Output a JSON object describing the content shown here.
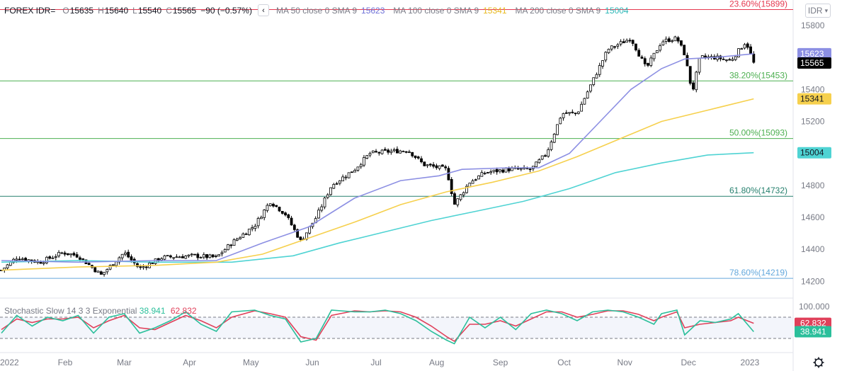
{
  "header": {
    "symbol": "FOREX IDR=",
    "o_label": "O",
    "o_value": "15635",
    "h_label": "H",
    "h_value": "15640",
    "l_label": "L",
    "l_value": "15540",
    "c_label": "C",
    "c_value": "15565",
    "change": "−90 (−0.57%)",
    "collapse_icon": "chevron-left-icon",
    "ma50_label": "MA 50 close 0 SMA 9",
    "ma50_value": "15623",
    "ma100_label": "MA 100 close 0 SMA 9",
    "ma100_value": "15341",
    "ma200_label": "MA 200 close 0 SMA 9",
    "ma200_value": "15004",
    "currency_button": "IDR"
  },
  "stochastic": {
    "label": "Stochastic Slow 14 3 3 Exponential",
    "k_value": "38.941",
    "d_value": "62.832",
    "scale_top": "100.000"
  },
  "colors": {
    "up": "#ffffff",
    "down": "#000000",
    "candle_border": "#000000",
    "ma50": "#8c8fe3",
    "ma100": "#f6d04d",
    "ma200": "#4fd3d3",
    "fib_red": "#e53950",
    "fib_green": "#4caf50",
    "fib_teal": "#26806e",
    "fib_blue": "#64a8dc",
    "stoch_k": "#2bbf9b",
    "stoch_d": "#e0405a",
    "price_label_bg": "#000000"
  },
  "chart_data": {
    "type": "candlestick",
    "y_range": [
      14100,
      15950
    ],
    "y_ticks": [
      14200,
      14400,
      14600,
      14800,
      15000,
      15200,
      15400,
      15600,
      15800
    ],
    "x_labels": [
      "2022",
      "Feb",
      "Mar",
      "Apr",
      "May",
      "Jun",
      "Jul",
      "Aug",
      "Sep",
      "Oct",
      "Nov",
      "Dec",
      "2023"
    ],
    "fib_levels": [
      {
        "label": "23.60%(15899)",
        "value": 15899,
        "color": "#e53950"
      },
      {
        "label": "38.20%(15453)",
        "value": 15453,
        "color": "#4caf50"
      },
      {
        "label": "50.00%(15093)",
        "value": 15093,
        "color": "#4caf50"
      },
      {
        "label": "61.80%(14732)",
        "value": 14732,
        "color": "#26806e"
      },
      {
        "label": "78.60%(14219)",
        "value": 14219,
        "color": "#64a8dc"
      }
    ],
    "last_price": "15565",
    "series": [
      {
        "name": "MA 50 close 0 SMA 9",
        "last": 15623
      },
      {
        "name": "MA 100 close 0 SMA 9",
        "last": 15341
      },
      {
        "name": "MA 200 close 0 SMA 9",
        "last": 15004
      }
    ],
    "close_path": [
      {
        "x": 0.0,
        "y": 14270
      },
      {
        "x": 0.02,
        "y": 14350
      },
      {
        "x": 0.05,
        "y": 14320
      },
      {
        "x": 0.08,
        "y": 14380
      },
      {
        "x": 0.1,
        "y": 14360
      },
      {
        "x": 0.13,
        "y": 14240
      },
      {
        "x": 0.16,
        "y": 14380
      },
      {
        "x": 0.18,
        "y": 14280
      },
      {
        "x": 0.21,
        "y": 14350
      },
      {
        "x": 0.25,
        "y": 14360
      },
      {
        "x": 0.28,
        "y": 14350
      },
      {
        "x": 0.3,
        "y": 14440
      },
      {
        "x": 0.33,
        "y": 14550
      },
      {
        "x": 0.35,
        "y": 14700
      },
      {
        "x": 0.37,
        "y": 14620
      },
      {
        "x": 0.39,
        "y": 14450
      },
      {
        "x": 0.41,
        "y": 14600
      },
      {
        "x": 0.43,
        "y": 14800
      },
      {
        "x": 0.46,
        "y": 14900
      },
      {
        "x": 0.48,
        "y": 15000
      },
      {
        "x": 0.5,
        "y": 15010
      },
      {
        "x": 0.53,
        "y": 15020
      },
      {
        "x": 0.55,
        "y": 14930
      },
      {
        "x": 0.58,
        "y": 14900
      },
      {
        "x": 0.59,
        "y": 14680
      },
      {
        "x": 0.61,
        "y": 14820
      },
      {
        "x": 0.63,
        "y": 14880
      },
      {
        "x": 0.66,
        "y": 14900
      },
      {
        "x": 0.69,
        "y": 14900
      },
      {
        "x": 0.71,
        "y": 15000
      },
      {
        "x": 0.73,
        "y": 15250
      },
      {
        "x": 0.75,
        "y": 15250
      },
      {
        "x": 0.77,
        "y": 15450
      },
      {
        "x": 0.79,
        "y": 15650
      },
      {
        "x": 0.82,
        "y": 15720
      },
      {
        "x": 0.84,
        "y": 15530
      },
      {
        "x": 0.86,
        "y": 15700
      },
      {
        "x": 0.88,
        "y": 15720
      },
      {
        "x": 0.89,
        "y": 15620
      },
      {
        "x": 0.9,
        "y": 15380
      },
      {
        "x": 0.91,
        "y": 15600
      },
      {
        "x": 0.93,
        "y": 15600
      },
      {
        "x": 0.95,
        "y": 15580
      },
      {
        "x": 0.97,
        "y": 15700
      },
      {
        "x": 0.98,
        "y": 15565
      }
    ],
    "ma50_path": [
      {
        "x": 0.0,
        "y": 14330
      },
      {
        "x": 0.1,
        "y": 14320
      },
      {
        "x": 0.2,
        "y": 14330
      },
      {
        "x": 0.28,
        "y": 14330
      },
      {
        "x": 0.34,
        "y": 14440
      },
      {
        "x": 0.4,
        "y": 14540
      },
      {
        "x": 0.46,
        "y": 14720
      },
      {
        "x": 0.52,
        "y": 14830
      },
      {
        "x": 0.57,
        "y": 14860
      },
      {
        "x": 0.6,
        "y": 14900
      },
      {
        "x": 0.66,
        "y": 14910
      },
      {
        "x": 0.7,
        "y": 14910
      },
      {
        "x": 0.74,
        "y": 15000
      },
      {
        "x": 0.78,
        "y": 15200
      },
      {
        "x": 0.82,
        "y": 15400
      },
      {
        "x": 0.86,
        "y": 15530
      },
      {
        "x": 0.89,
        "y": 15590
      },
      {
        "x": 0.93,
        "y": 15600
      },
      {
        "x": 0.98,
        "y": 15623
      }
    ],
    "ma100_path": [
      {
        "x": 0.0,
        "y": 14270
      },
      {
        "x": 0.1,
        "y": 14290
      },
      {
        "x": 0.2,
        "y": 14300
      },
      {
        "x": 0.28,
        "y": 14320
      },
      {
        "x": 0.34,
        "y": 14370
      },
      {
        "x": 0.4,
        "y": 14470
      },
      {
        "x": 0.46,
        "y": 14570
      },
      {
        "x": 0.52,
        "y": 14680
      },
      {
        "x": 0.58,
        "y": 14760
      },
      {
        "x": 0.64,
        "y": 14820
      },
      {
        "x": 0.7,
        "y": 14890
      },
      {
        "x": 0.75,
        "y": 14980
      },
      {
        "x": 0.8,
        "y": 15080
      },
      {
        "x": 0.86,
        "y": 15200
      },
      {
        "x": 0.92,
        "y": 15270
      },
      {
        "x": 0.98,
        "y": 15341
      }
    ],
    "ma200_path": [
      {
        "x": 0.0,
        "y": 14320
      },
      {
        "x": 0.1,
        "y": 14330
      },
      {
        "x": 0.2,
        "y": 14320
      },
      {
        "x": 0.3,
        "y": 14320
      },
      {
        "x": 0.38,
        "y": 14360
      },
      {
        "x": 0.44,
        "y": 14440
      },
      {
        "x": 0.5,
        "y": 14510
      },
      {
        "x": 0.56,
        "y": 14580
      },
      {
        "x": 0.62,
        "y": 14640
      },
      {
        "x": 0.68,
        "y": 14700
      },
      {
        "x": 0.74,
        "y": 14780
      },
      {
        "x": 0.8,
        "y": 14880
      },
      {
        "x": 0.86,
        "y": 14940
      },
      {
        "x": 0.92,
        "y": 14990
      },
      {
        "x": 0.98,
        "y": 15004
      }
    ],
    "stoch_k_path": [
      {
        "x": 0.0,
        "y": 35
      },
      {
        "x": 0.02,
        "y": 85
      },
      {
        "x": 0.04,
        "y": 55
      },
      {
        "x": 0.06,
        "y": 80
      },
      {
        "x": 0.08,
        "y": 70
      },
      {
        "x": 0.1,
        "y": 85
      },
      {
        "x": 0.12,
        "y": 35
      },
      {
        "x": 0.14,
        "y": 80
      },
      {
        "x": 0.16,
        "y": 90
      },
      {
        "x": 0.18,
        "y": 35
      },
      {
        "x": 0.2,
        "y": 50
      },
      {
        "x": 0.22,
        "y": 70
      },
      {
        "x": 0.24,
        "y": 95
      },
      {
        "x": 0.26,
        "y": 60
      },
      {
        "x": 0.28,
        "y": 40
      },
      {
        "x": 0.3,
        "y": 95
      },
      {
        "x": 0.33,
        "y": 100
      },
      {
        "x": 0.35,
        "y": 85
      },
      {
        "x": 0.37,
        "y": 75
      },
      {
        "x": 0.39,
        "y": 10
      },
      {
        "x": 0.41,
        "y": 20
      },
      {
        "x": 0.43,
        "y": 100
      },
      {
        "x": 0.46,
        "y": 95
      },
      {
        "x": 0.48,
        "y": 95
      },
      {
        "x": 0.5,
        "y": 100
      },
      {
        "x": 0.52,
        "y": 90
      },
      {
        "x": 0.54,
        "y": 70
      },
      {
        "x": 0.56,
        "y": 40
      },
      {
        "x": 0.58,
        "y": 15
      },
      {
        "x": 0.59,
        "y": 5
      },
      {
        "x": 0.61,
        "y": 80
      },
      {
        "x": 0.63,
        "y": 50
      },
      {
        "x": 0.65,
        "y": 80
      },
      {
        "x": 0.67,
        "y": 45
      },
      {
        "x": 0.69,
        "y": 90
      },
      {
        "x": 0.71,
        "y": 100
      },
      {
        "x": 0.73,
        "y": 90
      },
      {
        "x": 0.75,
        "y": 70
      },
      {
        "x": 0.77,
        "y": 95
      },
      {
        "x": 0.79,
        "y": 100
      },
      {
        "x": 0.81,
        "y": 95
      },
      {
        "x": 0.83,
        "y": 80
      },
      {
        "x": 0.85,
        "y": 60
      },
      {
        "x": 0.86,
        "y": 90
      },
      {
        "x": 0.88,
        "y": 100
      },
      {
        "x": 0.89,
        "y": 30
      },
      {
        "x": 0.91,
        "y": 70
      },
      {
        "x": 0.93,
        "y": 65
      },
      {
        "x": 0.95,
        "y": 75
      },
      {
        "x": 0.96,
        "y": 90
      },
      {
        "x": 0.98,
        "y": 38.941
      }
    ],
    "stoch_d_path": [
      {
        "x": 0.0,
        "y": 45
      },
      {
        "x": 0.02,
        "y": 75
      },
      {
        "x": 0.04,
        "y": 65
      },
      {
        "x": 0.06,
        "y": 75
      },
      {
        "x": 0.08,
        "y": 75
      },
      {
        "x": 0.1,
        "y": 80
      },
      {
        "x": 0.12,
        "y": 50
      },
      {
        "x": 0.14,
        "y": 70
      },
      {
        "x": 0.16,
        "y": 85
      },
      {
        "x": 0.18,
        "y": 50
      },
      {
        "x": 0.2,
        "y": 45
      },
      {
        "x": 0.22,
        "y": 65
      },
      {
        "x": 0.24,
        "y": 85
      },
      {
        "x": 0.26,
        "y": 70
      },
      {
        "x": 0.28,
        "y": 50
      },
      {
        "x": 0.3,
        "y": 80
      },
      {
        "x": 0.33,
        "y": 98
      },
      {
        "x": 0.35,
        "y": 90
      },
      {
        "x": 0.37,
        "y": 80
      },
      {
        "x": 0.39,
        "y": 25
      },
      {
        "x": 0.41,
        "y": 15
      },
      {
        "x": 0.43,
        "y": 85
      },
      {
        "x": 0.46,
        "y": 98
      },
      {
        "x": 0.48,
        "y": 95
      },
      {
        "x": 0.5,
        "y": 98
      },
      {
        "x": 0.52,
        "y": 95
      },
      {
        "x": 0.54,
        "y": 80
      },
      {
        "x": 0.56,
        "y": 55
      },
      {
        "x": 0.58,
        "y": 25
      },
      {
        "x": 0.59,
        "y": 12
      },
      {
        "x": 0.61,
        "y": 60
      },
      {
        "x": 0.63,
        "y": 60
      },
      {
        "x": 0.65,
        "y": 70
      },
      {
        "x": 0.67,
        "y": 55
      },
      {
        "x": 0.69,
        "y": 75
      },
      {
        "x": 0.71,
        "y": 95
      },
      {
        "x": 0.73,
        "y": 95
      },
      {
        "x": 0.75,
        "y": 80
      },
      {
        "x": 0.77,
        "y": 88
      },
      {
        "x": 0.79,
        "y": 98
      },
      {
        "x": 0.81,
        "y": 98
      },
      {
        "x": 0.83,
        "y": 88
      },
      {
        "x": 0.85,
        "y": 70
      },
      {
        "x": 0.86,
        "y": 80
      },
      {
        "x": 0.88,
        "y": 95
      },
      {
        "x": 0.89,
        "y": 50
      },
      {
        "x": 0.91,
        "y": 60
      },
      {
        "x": 0.93,
        "y": 65
      },
      {
        "x": 0.95,
        "y": 70
      },
      {
        "x": 0.96,
        "y": 80
      },
      {
        "x": 0.98,
        "y": 62.832
      }
    ],
    "stoch_bands": [
      20,
      80
    ]
  }
}
